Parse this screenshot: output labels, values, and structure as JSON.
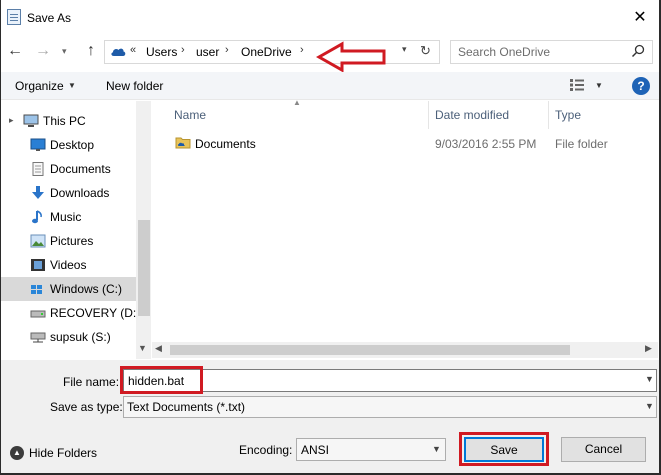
{
  "window": {
    "title": "Save As"
  },
  "navigation": {
    "breadcrumb": [
      "Users",
      "user",
      "OneDrive"
    ],
    "overflow_marker": "«",
    "search_placeholder": "Search OneDrive"
  },
  "toolbar": {
    "organize_label": "Organize",
    "new_folder_label": "New folder",
    "help_label": "?"
  },
  "nav_pane": {
    "items": [
      {
        "label": "This PC",
        "icon": "computer-icon",
        "selected": false
      },
      {
        "label": "Desktop",
        "icon": "desktop-icon",
        "selected": false
      },
      {
        "label": "Documents",
        "icon": "documents-icon",
        "selected": false
      },
      {
        "label": "Downloads",
        "icon": "downloads-icon",
        "selected": false
      },
      {
        "label": "Music",
        "icon": "music-icon",
        "selected": false
      },
      {
        "label": "Pictures",
        "icon": "pictures-icon",
        "selected": false
      },
      {
        "label": "Videos",
        "icon": "videos-icon",
        "selected": false
      },
      {
        "label": "Windows (C:)",
        "icon": "drive-icon",
        "selected": true
      },
      {
        "label": "RECOVERY (D:)",
        "icon": "drive-icon",
        "selected": false
      },
      {
        "label": "supsuk (S:)",
        "icon": "network-drive-icon",
        "selected": false
      }
    ]
  },
  "file_list": {
    "columns": [
      "Name",
      "Date modified",
      "Type"
    ],
    "rows": [
      {
        "name": "Documents",
        "date": "9/03/2016 2:55 PM",
        "type": "File folder"
      }
    ]
  },
  "form": {
    "filename_label": "File name:",
    "filename_value": "hidden.bat",
    "saveas_label": "Save as type:",
    "saveas_value": "Text Documents (*.txt)",
    "encoding_label": "Encoding:",
    "encoding_value": "ANSI",
    "hide_folders_label": "Hide Folders",
    "save_label": "Save",
    "cancel_label": "Cancel"
  },
  "colors": {
    "annotation_red": "#d01a22",
    "accent_blue": "#0078d7",
    "selected_bg": "#d9d9d9",
    "header_text": "#4c607a"
  }
}
